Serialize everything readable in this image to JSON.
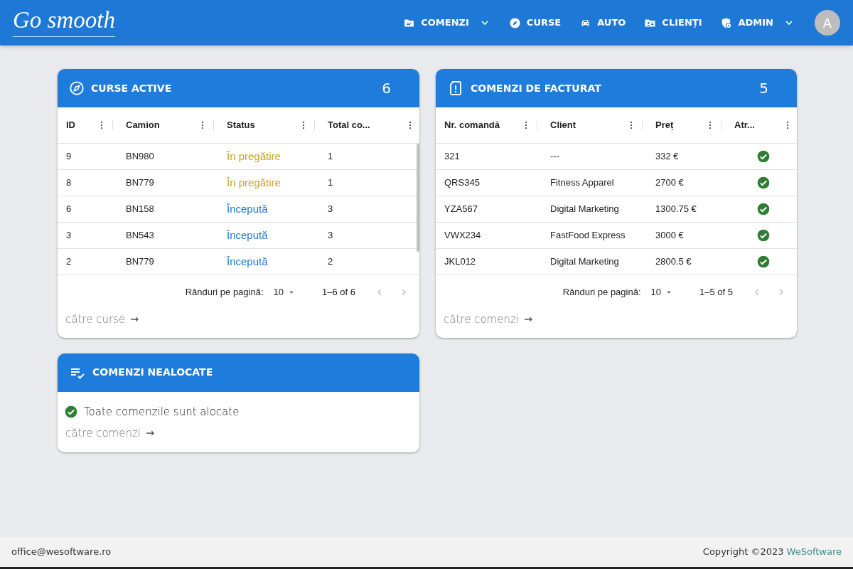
{
  "header": {
    "logo": "Go smooth",
    "nav": [
      {
        "label": "COMENZI",
        "kind": "orders",
        "dropdown": true
      },
      {
        "label": "CURSE",
        "kind": "trips",
        "dropdown": false
      },
      {
        "label": "AUTO",
        "kind": "vehicles",
        "dropdown": false
      },
      {
        "label": "CLIENȚI",
        "kind": "clients",
        "dropdown": false
      },
      {
        "label": "ADMIN",
        "kind": "admin",
        "dropdown": true
      }
    ],
    "avatar": "A"
  },
  "curse_active": {
    "title": "CURSE ACTIVE",
    "count": "6",
    "columns": [
      "ID",
      "Camion",
      "Status",
      "Total co..."
    ],
    "rows": [
      {
        "id": "9",
        "camion": "BN980",
        "status": "În pregătire",
        "kind": "preparing",
        "total": "1"
      },
      {
        "id": "8",
        "camion": "BN779",
        "status": "În pregătire",
        "kind": "preparing",
        "total": "1"
      },
      {
        "id": "6",
        "camion": "BN158",
        "status": "Începută",
        "kind": "started",
        "total": "3"
      },
      {
        "id": "3",
        "camion": "BN543",
        "status": "Începută",
        "kind": "started",
        "total": "3"
      },
      {
        "id": "2",
        "camion": "BN779",
        "status": "Începută",
        "kind": "started",
        "total": "2"
      }
    ],
    "pagination": {
      "label": "Rânduri pe pagină:",
      "per_page": "10",
      "range": "1–6 of 6"
    },
    "link": "către curse"
  },
  "comenzi_de_facturat": {
    "title": "COMENZI DE FACTURAT",
    "count": "5",
    "columns": [
      "Nr. comandă",
      "Client",
      "Preț",
      "Atr..."
    ],
    "rows": [
      {
        "nr": "321",
        "client": "---",
        "pret": "332 €",
        "attributed": true
      },
      {
        "nr": "QRS345",
        "client": "Fitness Apparel",
        "pret": "2700 €",
        "attributed": true
      },
      {
        "nr": "YZA567",
        "client": "Digital Marketing",
        "pret": "1300.75 €",
        "attributed": true
      },
      {
        "nr": "VWX234",
        "client": "FastFood Express",
        "pret": "3000 €",
        "attributed": true
      },
      {
        "nr": "JKL012",
        "client": "Digital Marketing",
        "pret": "2800.5 €",
        "attributed": true
      }
    ],
    "pagination": {
      "label": "Rânduri pe pagină:",
      "per_page": "10",
      "range": "1–5 of 5"
    },
    "link": "către comenzi"
  },
  "comenzi_nealocate": {
    "title": "COMENZI NEALOCATE",
    "message": "Toate comenzile sunt alocate",
    "link": "către comenzi"
  },
  "footer": {
    "email": "office@wesoftware.ro",
    "copyright": "Copyright ©2023",
    "company": "WeSoftware"
  }
}
